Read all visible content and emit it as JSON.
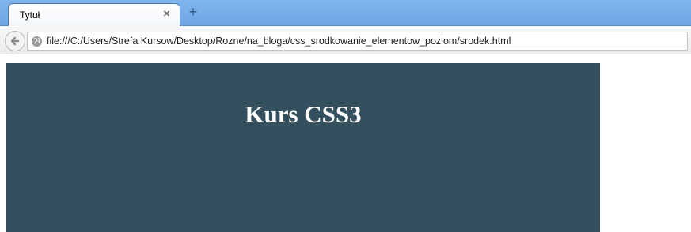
{
  "browser": {
    "tab": {
      "title": "Tytuł",
      "close_icon": "close-icon"
    },
    "new_tab_icon": "plus-icon",
    "toolbar": {
      "back_icon": "back-arrow-icon",
      "address": {
        "icon": "globe-icon",
        "url": "file:///C:/Users/Strefa Kursow/Desktop/Rozne/na_bloga/css_srodkowanie_elementow_poziom/srodek.html"
      }
    }
  },
  "page": {
    "heading": "Kurs CSS3",
    "box_color": "#34505e",
    "heading_color": "#ffffff"
  }
}
